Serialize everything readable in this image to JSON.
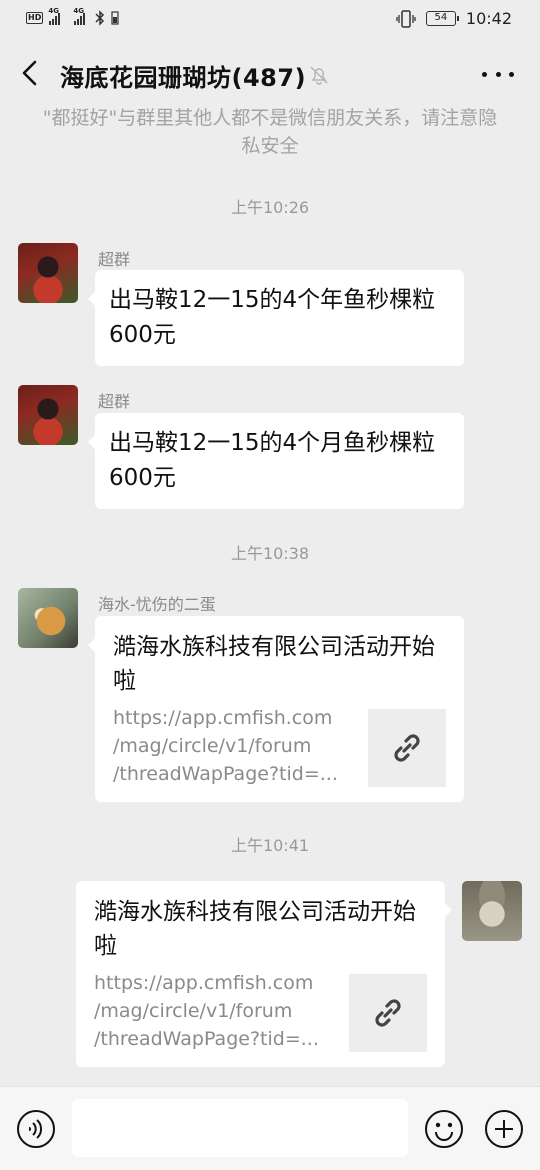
{
  "status_bar": {
    "hd_label": "HD",
    "sim1_network": "4G",
    "sim2_network": "4G",
    "battery_level": "54",
    "time": "10:42"
  },
  "header": {
    "title": "海底花园珊瑚坊(487)",
    "back_icon": "chevron-left-icon",
    "mute_icon": "bell-off-icon",
    "more_icon": "more-dots-icon"
  },
  "notice": "\"都挺好\"与群里其他人都不是微信朋友关系，请注意隐私安全",
  "messages": [
    {
      "timestamp": "上午10:26",
      "sender": "超群",
      "text": "出马鞍12一15的4个年鱼秒棵粒600元"
    },
    {
      "sender": "超群",
      "text": "出马鞍12一15的4个月鱼秒棵粒600元"
    },
    {
      "timestamp": "上午10:38",
      "sender": "海水-忧伤的二蛋",
      "link_title": "澔海水族科技有限公司活动开始啦",
      "link_url_lines": [
        "https://app.cmfish.com",
        "/mag/circle/v1/forum",
        "/threadWapPage?tid=..."
      ]
    },
    {
      "timestamp": "上午10:41",
      "sender": "",
      "link_title": "澔海水族科技有限公司活动开始啦",
      "link_url_lines": [
        "https://app.cmfish.com",
        "/mag/circle/v1/forum",
        "/threadWapPage?tid=..."
      ]
    }
  ],
  "input_bar": {
    "voice_icon": "voice-icon",
    "emoji_icon": "emoji-icon",
    "plus_icon": "plus-icon",
    "input_value": ""
  }
}
